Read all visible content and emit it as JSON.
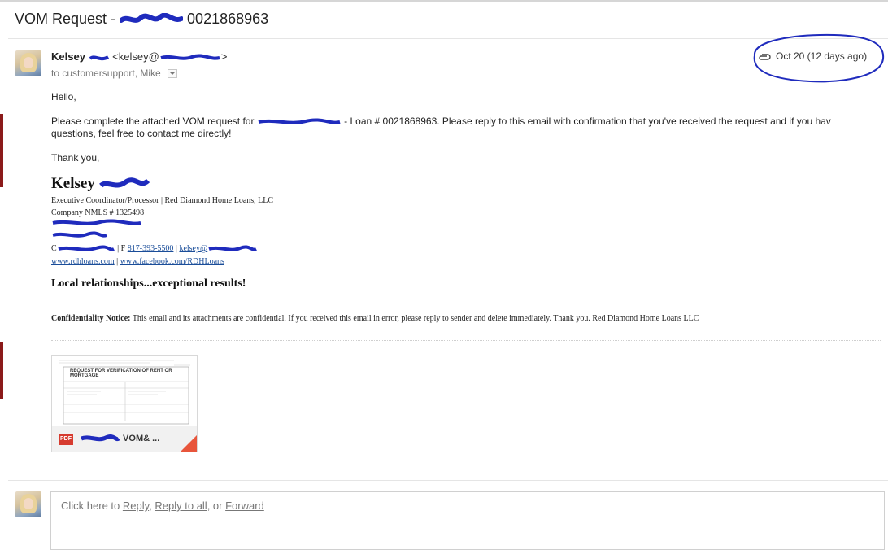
{
  "email": {
    "subject_prefix": "VOM Request - ",
    "subject_suffix": " 0021868963",
    "sender_name": "Kelsey",
    "sender_email_start": "<kelsey@",
    "sender_email_end": ">",
    "to_line": "to customersupport, Mike",
    "date": "Oct 20 (12 days ago)"
  },
  "body": {
    "greeting": "Hello,",
    "line1_a": "Please complete the attached VOM request for",
    "line1_b": " - Loan # 0021868963. Please reply to this email with confirmation that you've received the request and if you hav",
    "line2": "questions, feel free to contact me directly!",
    "thanks": "Thank you,"
  },
  "signature": {
    "name": "Kelsey",
    "title": "Executive Coordinator/Processor  |  Red Diamond Home Loans, LLC",
    "nmls": "Company NMLS # 1325498",
    "contact_c": "C",
    "contact_sep1": " | F ",
    "fax": "817-393-5500",
    "contact_sep2": "  |  ",
    "email_start": "kelsey@",
    "website": "www.rdhloans.com",
    "web_sep": "  |  ",
    "facebook": "www.facebook.com/RDHLoans",
    "tagline": "Local relationships...exceptional results!",
    "conf_label": "Confidentiality Notice:",
    "conf_text": " This email and its attachments are confidential. If you received this email in error, please reply to sender and delete immediately. Thank you. Red Diamond Home Loans LLC"
  },
  "attachment": {
    "badge": "PDF",
    "filename": " VOM& ...",
    "preview_title": "REQUEST FOR VERIFICATION OF RENT OR MORTGAGE"
  },
  "reply": {
    "prefix": "Click here to ",
    "reply": "Reply",
    "sep1": ", ",
    "reply_all": "Reply to all",
    "sep2": ", or ",
    "forward": "Forward"
  },
  "colors": {
    "annotation_ink": "#1f2bbd",
    "link": "#1a4d99",
    "pdf_red": "#d63b2f"
  }
}
